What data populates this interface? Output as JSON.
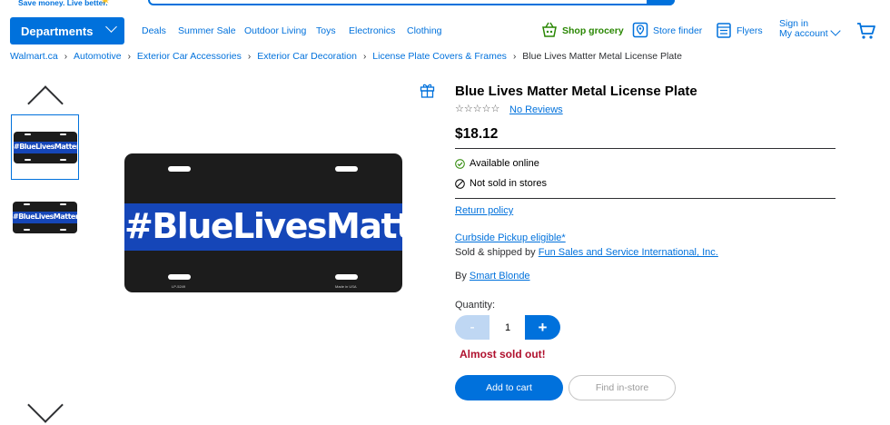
{
  "header": {
    "tagline": "Save money. Live better.",
    "departments_label": "Departments",
    "nav_links": [
      "Deals",
      "Summer Sale",
      "Outdoor Living",
      "Toys",
      "Electronics",
      "Clothing"
    ],
    "shop_grocery": "Shop grocery",
    "store_finder": "Store finder",
    "flyers": "Flyers",
    "sign_in": "Sign in",
    "my_account": "My account",
    "icons": [
      "spark-icon",
      "basket-icon",
      "store-pin-icon",
      "flyer-icon",
      "cart-icon",
      "chevron-down-icon"
    ],
    "colors": {
      "brand_blue": "#0071dc",
      "grocery_green": "#2a8703",
      "spark_yellow": "#ffc220"
    }
  },
  "breadcrumb": {
    "items": [
      "Walmart.ca",
      "Automotive",
      "Exterior Car Accessories",
      "Exterior Car Decoration",
      "License Plate Covers & Frames"
    ],
    "current": "Blue Lives Matter Metal License Plate"
  },
  "gallery": {
    "plate_text": "#BlueLivesMatter",
    "plate_code": "LP-5249",
    "plate_origin": "Made in USA",
    "thumbnail_count": 2,
    "selected_thumbnail": 1
  },
  "product": {
    "title": "Blue Lives Matter Metal License Plate",
    "stars": "☆☆☆☆☆",
    "rating": 0,
    "reviews_label": "No Reviews",
    "price": "$18.12",
    "availability_online": "Available online",
    "availability_store": "Not sold in stores",
    "return_policy": "Return policy",
    "curbside": "Curbside Pickup eligible*",
    "sold_by_prefix": "Sold & shipped by",
    "seller": "Fun Sales and Service International, Inc.",
    "by_prefix": "By",
    "brand": "Smart Blonde",
    "quantity_label": "Quantity:",
    "quantity_value": "1",
    "minus": "-",
    "plus": "+",
    "stock_warning": "Almost sold out!",
    "add_to_cart": "Add to cart",
    "find_in_store": "Find in-store",
    "colors": {
      "warning_red": "#b0112e",
      "button_blue": "#0071dc",
      "minus_disabled": "#bfd7f3"
    }
  }
}
